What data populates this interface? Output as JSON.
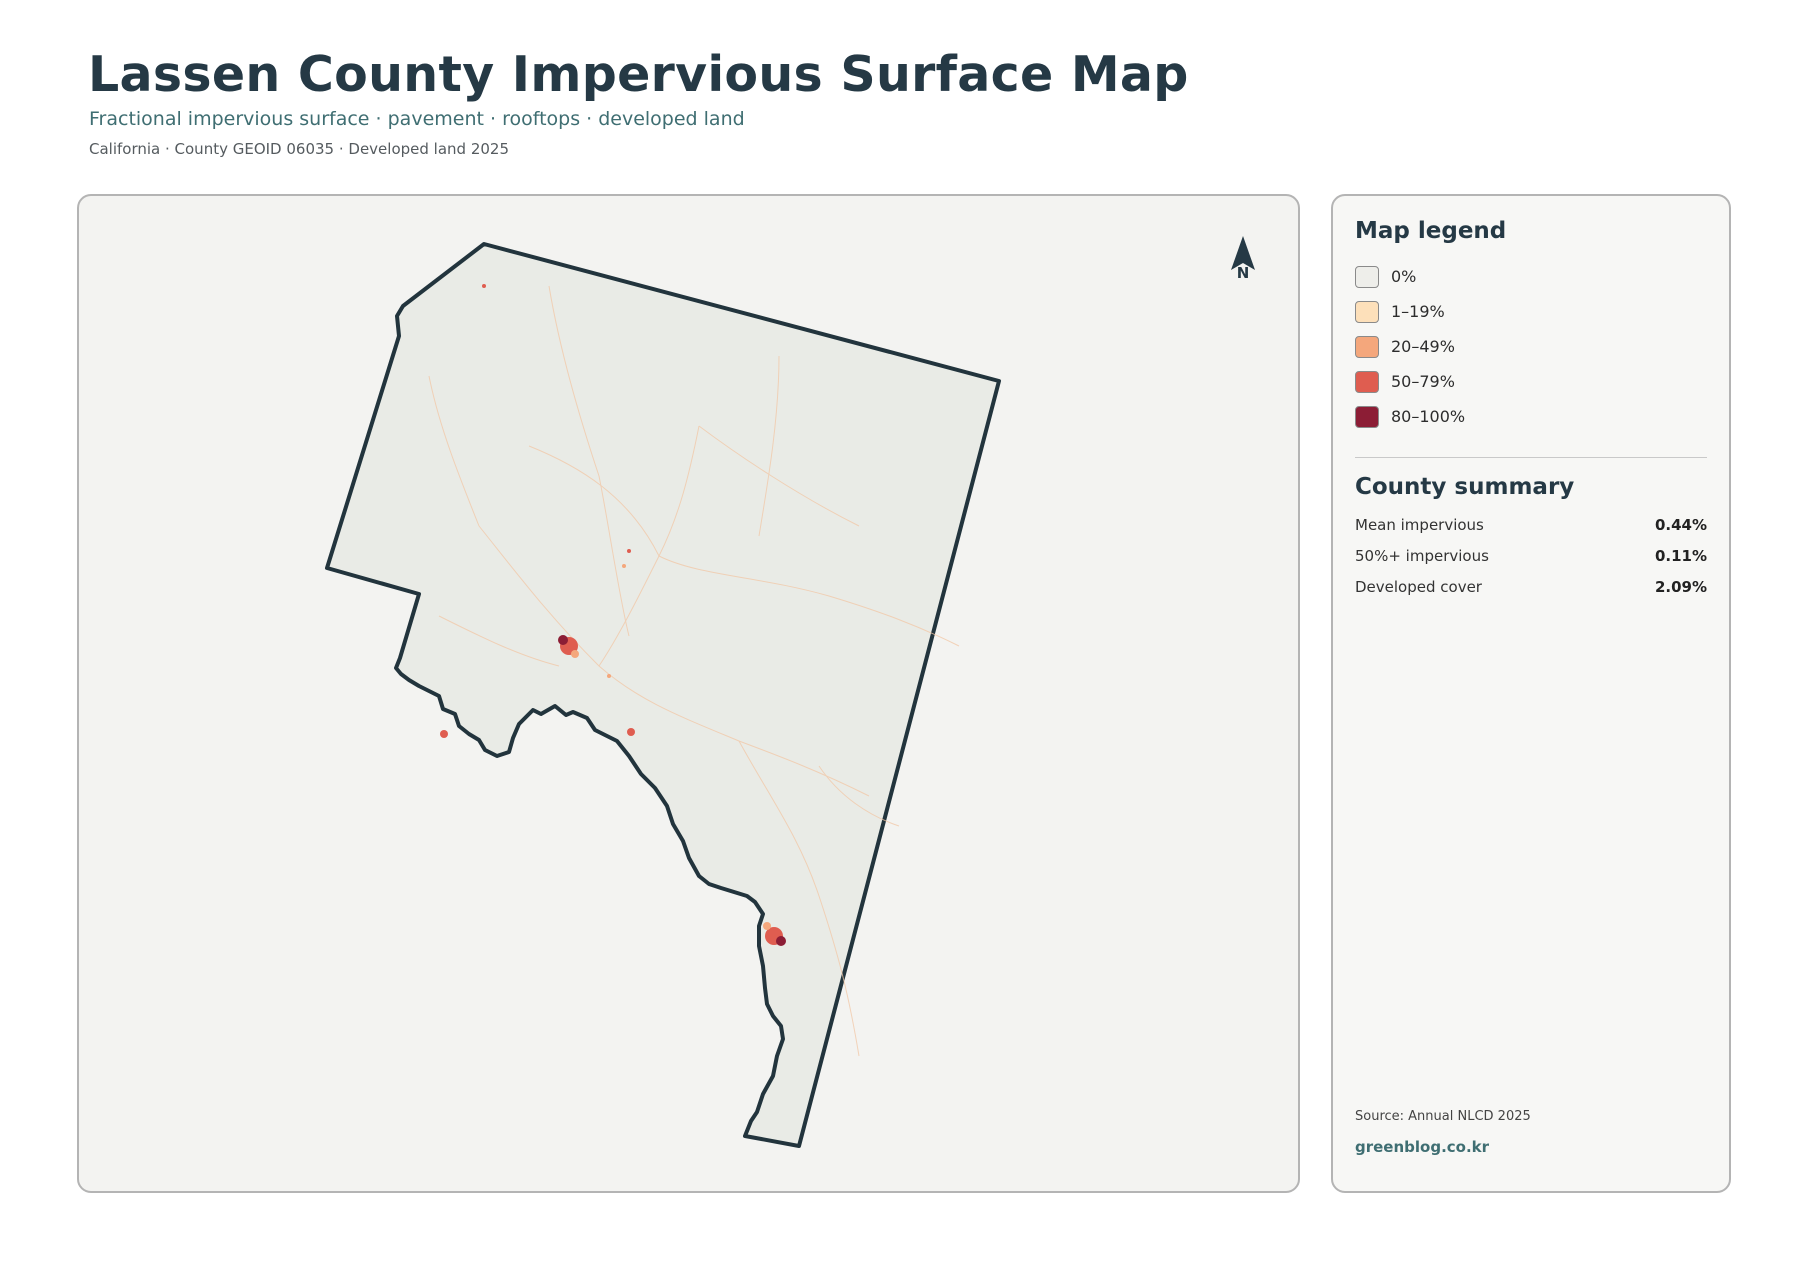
{
  "header": {
    "title": "Lassen County Impervious Surface Map",
    "subtitle": "Fractional impervious surface · pavement · rooftops · developed land",
    "meta": "California · County GEOID 06035 · Developed land 2025"
  },
  "map": {
    "north_label": "N",
    "county_fill": "#e9ebe6",
    "county_stroke": "#22343d"
  },
  "legend": {
    "title": "Map legend",
    "items": [
      {
        "label": "0%",
        "color": "#eeeeea"
      },
      {
        "label": "1–19%",
        "color": "#fde0ba"
      },
      {
        "label": "20–49%",
        "color": "#f4a77c"
      },
      {
        "label": "50–79%",
        "color": "#df5d50"
      },
      {
        "label": "80–100%",
        "color": "#8c1d35"
      }
    ]
  },
  "summary": {
    "title": "County summary",
    "rows": [
      {
        "label": "Mean impervious",
        "value": "0.44%"
      },
      {
        "label": "50%+ impervious",
        "value": "0.11%"
      },
      {
        "label": "Developed cover",
        "value": "2.09%"
      }
    ]
  },
  "footer": {
    "source": "Source: Annual NLCD 2025",
    "credit": "greenblog.co.kr"
  }
}
